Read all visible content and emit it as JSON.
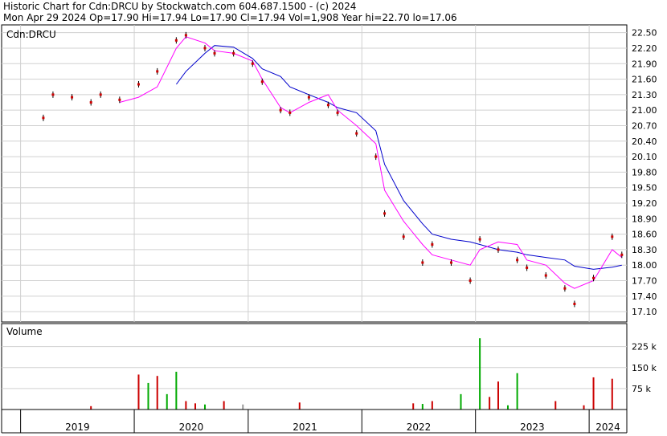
{
  "header": {
    "line1": "Historic Chart for Cdn:DRCU by Stockwatch.com 604.687.1500 - (c) 2024",
    "line2": "Mon Apr 29 2024  Op=17.90  Hi=17.94  Lo=17.90  Cl=17.94  Vol=1,908  Year hi=22.70  lo=17.06"
  },
  "chart_data": [
    {
      "type": "line",
      "title": "Cdn:DRCU",
      "ylim": [
        16.9,
        22.65
      ],
      "y_ticks": [
        22.5,
        22.2,
        21.9,
        21.6,
        21.3,
        21.0,
        20.7,
        20.4,
        20.1,
        19.8,
        19.5,
        19.2,
        18.9,
        18.6,
        18.3,
        18.0,
        17.7,
        17.4,
        17.1
      ],
      "x_ticks": [
        "2019",
        "2020",
        "2021",
        "2022",
        "2023",
        "2024"
      ],
      "grid": true,
      "colors": {
        "price": "#cc0000",
        "ma_short": "#ff00ff",
        "ma_long": "#0000cc",
        "grid": "#d0d0d0",
        "divider": "#000000"
      },
      "x": [
        "2019-03",
        "2019-04",
        "2019-06",
        "2019-08",
        "2019-09",
        "2019-11",
        "2020-01",
        "2020-03",
        "2020-05",
        "2020-06",
        "2020-08",
        "2020-09",
        "2020-11",
        "2021-01",
        "2021-02",
        "2021-04",
        "2021-05",
        "2021-07",
        "2021-09",
        "2021-10",
        "2021-12",
        "2022-02",
        "2022-03",
        "2022-05",
        "2022-07",
        "2022-08",
        "2022-10",
        "2022-12",
        "2023-01",
        "2023-03",
        "2023-05",
        "2023-06",
        "2023-08",
        "2023-10",
        "2023-11",
        "2024-01",
        "2024-03",
        "2024-04"
      ],
      "series": [
        {
          "key": "price",
          "values": [
            20.85,
            21.3,
            21.25,
            21.15,
            21.3,
            21.2,
            21.5,
            21.75,
            22.35,
            22.45,
            22.2,
            22.1,
            22.1,
            21.9,
            21.55,
            21.0,
            20.95,
            21.25,
            21.1,
            20.95,
            20.55,
            20.1,
            19.0,
            18.55,
            18.05,
            18.4,
            18.05,
            17.7,
            18.5,
            18.3,
            18.1,
            17.95,
            17.8,
            17.55,
            17.25,
            17.75,
            18.55,
            18.2
          ]
        },
        {
          "key": "ma_short",
          "values": [
            null,
            null,
            null,
            null,
            null,
            21.15,
            21.25,
            21.45,
            22.2,
            22.42,
            22.3,
            22.15,
            22.1,
            21.95,
            21.6,
            21.05,
            20.95,
            21.15,
            21.3,
            21.0,
            20.7,
            20.35,
            19.45,
            18.85,
            18.4,
            18.2,
            18.1,
            18.0,
            18.3,
            18.45,
            18.4,
            18.1,
            18.0,
            17.65,
            17.55,
            17.7,
            18.3,
            18.15
          ]
        },
        {
          "key": "ma_long",
          "values": [
            null,
            null,
            null,
            null,
            null,
            null,
            null,
            null,
            21.5,
            21.75,
            22.1,
            22.25,
            22.22,
            22.0,
            21.8,
            21.65,
            21.45,
            21.3,
            21.15,
            21.05,
            20.95,
            20.6,
            19.95,
            19.25,
            18.8,
            18.6,
            18.5,
            18.45,
            18.4,
            18.3,
            18.25,
            18.2,
            18.15,
            18.1,
            17.98,
            17.92,
            17.96,
            18.0
          ]
        }
      ]
    },
    {
      "type": "bar",
      "title": "Volume",
      "ylim": [
        0,
        290
      ],
      "y_ticks": [
        225,
        150,
        75
      ],
      "y_tick_labels": [
        "225 k",
        "150 k",
        "75 k"
      ],
      "colors": {
        "up": "#00aa00",
        "down": "#cc0000",
        "flat": "#999999"
      },
      "x": [
        "2019-08",
        "2020-01",
        "2020-02",
        "2020-03",
        "2020-04",
        "2020-05",
        "2020-06",
        "2020-07",
        "2020-08",
        "2020-10",
        "2020-12",
        "2021-06",
        "2022-06",
        "2022-07",
        "2022-08",
        "2022-11",
        "2023-01",
        "2023-02",
        "2023-03",
        "2023-04",
        "2023-05",
        "2023-09",
        "2023-12",
        "2024-01",
        "2024-03"
      ],
      "values": [
        12,
        125,
        95,
        120,
        55,
        135,
        30,
        22,
        18,
        30,
        18,
        25,
        22,
        20,
        30,
        55,
        255,
        45,
        100,
        15,
        130,
        30,
        15,
        115,
        110
      ],
      "direction": [
        "down",
        "down",
        "up",
        "down",
        "up",
        "up",
        "down",
        "down",
        "up",
        "down",
        "flat",
        "down",
        "down",
        "up",
        "down",
        "up",
        "up",
        "down",
        "down",
        "up",
        "up",
        "down",
        "down",
        "down",
        "down"
      ]
    }
  ]
}
